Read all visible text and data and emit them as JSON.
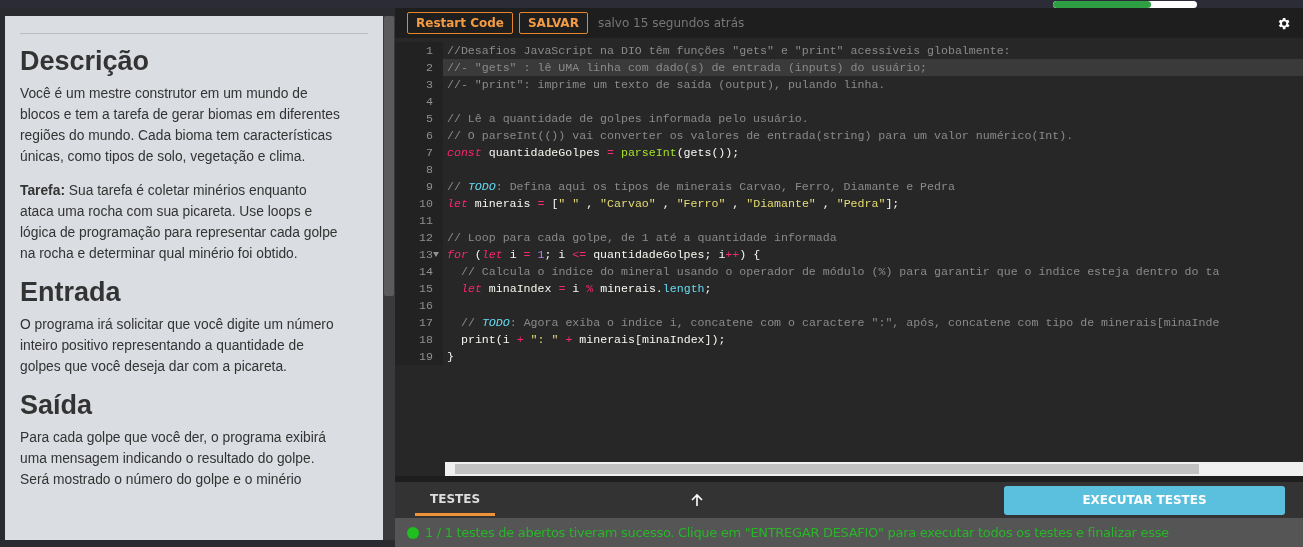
{
  "top_bar": {
    "progress": {
      "level": 0.68
    }
  },
  "description": {
    "sections": [
      {
        "heading": "Descrição",
        "paragraphs": [
          "Você é um mestre construtor em um mundo de blocos e tem a tarefa de gerar biomas em diferentes regiões do mundo. Cada bioma tem características únicas, como tipos de solo, vegetação e clima.",
          "**Tarefa:** Sua tarefa é coletar minérios enquanto ataca uma rocha com sua picareta. Use loops e lógica de programação para representar cada golpe na rocha e determinar qual minério foi obtido."
        ]
      },
      {
        "heading": "Entrada",
        "paragraphs": [
          "O programa irá solicitar que você digite um número inteiro positivo representando a quantidade de golpes que você deseja dar com a picareta."
        ]
      },
      {
        "heading": "Saída",
        "paragraphs": [
          "Para cada golpe que você der, o programa exibirá uma mensagem indicando o resultado do golpe. Será mostrado o número do golpe e o minério"
        ]
      }
    ]
  },
  "toolbar": {
    "buttons": [
      "Restart Code",
      "SALVAR"
    ],
    "save_status": "salvo 15 segundos atrás"
  },
  "editor": {
    "lines": [
      {
        "number": "1",
        "active": false,
        "foldable": false,
        "tokens": [
          {
            "kind": "comment",
            "text": "//Desafios JavaScript na DIO têm funções \"gets\" e \"print\" acessíveis globalmente:"
          }
        ]
      },
      {
        "number": "2",
        "active": true,
        "foldable": false,
        "tokens": [
          {
            "kind": "comment",
            "text": "//- \"gets\" : lê UMA linha com dado(s) de entrada (inputs) do usuário;"
          }
        ]
      },
      {
        "number": "3",
        "active": false,
        "foldable": false,
        "tokens": [
          {
            "kind": "comment",
            "text": "//- \"print\": imprime um texto de saída (output), pulando linha."
          }
        ]
      },
      {
        "number": "4",
        "active": false,
        "foldable": false
      },
      {
        "number": "5",
        "active": false,
        "foldable": false,
        "tokens": [
          {
            "kind": "comment",
            "text": "// Lê a quantidade de golpes informada pelo usuário."
          }
        ]
      },
      {
        "number": "6",
        "active": false,
        "foldable": false,
        "tokens": [
          {
            "kind": "comment",
            "text": "// O parseInt(()) vai converter os valores de entrada(string) para um valor numérico(Int)."
          }
        ]
      },
      {
        "number": "7",
        "active": false,
        "foldable": false,
        "tokens": [
          {
            "kind": "keyword",
            "text": "const"
          },
          {
            "kind": "plain",
            "text": " quantidadeGolpes "
          },
          {
            "kind": "operator",
            "text": "="
          },
          {
            "kind": "function",
            "text": " parseInt"
          },
          {
            "kind": "plain",
            "text": "(gets());"
          }
        ]
      },
      {
        "number": "8",
        "active": false,
        "foldable": false
      },
      {
        "number": "9",
        "active": false,
        "foldable": false,
        "tokens": [
          {
            "kind": "comment",
            "text": "// "
          },
          {
            "kind": "todo",
            "text": "TODO"
          },
          {
            "kind": "comment",
            "text": ": Defina aqui os tipos de minerais Carvao, Ferro, Diamante e Pedra"
          }
        ]
      },
      {
        "number": "10",
        "active": false,
        "foldable": false,
        "tokens": [
          {
            "kind": "keyword",
            "text": "let"
          },
          {
            "kind": "plain",
            "text": " minerais "
          },
          {
            "kind": "operator",
            "text": "="
          },
          {
            "kind": "plain",
            "text": " ["
          },
          {
            "kind": "string",
            "text": "\" \""
          },
          {
            "kind": "plain",
            "text": " , "
          },
          {
            "kind": "string",
            "text": "\"Carvao\""
          },
          {
            "kind": "plain",
            "text": " , "
          },
          {
            "kind": "string",
            "text": "\"Ferro\""
          },
          {
            "kind": "plain",
            "text": " , "
          },
          {
            "kind": "string",
            "text": "\"Diamante\""
          },
          {
            "kind": "plain",
            "text": " , "
          },
          {
            "kind": "string",
            "text": "\"Pedra\""
          },
          {
            "kind": "plain",
            "text": "];"
          }
        ]
      },
      {
        "number": "11",
        "active": false,
        "foldable": false
      },
      {
        "number": "12",
        "active": false,
        "foldable": false,
        "tokens": [
          {
            "kind": "comment",
            "text": "// Loop para cada golpe, de 1 até a quantidade informada"
          }
        ]
      },
      {
        "number": "13",
        "active": false,
        "foldable": true,
        "tokens": [
          {
            "kind": "keyword",
            "text": "for"
          },
          {
            "kind": "plain",
            "text": " ("
          },
          {
            "kind": "keyword",
            "text": "let"
          },
          {
            "kind": "plain",
            "text": " i "
          },
          {
            "kind": "operator",
            "text": "="
          },
          {
            "kind": "number",
            "text": " 1"
          },
          {
            "kind": "plain",
            "text": "; i "
          },
          {
            "kind": "operator",
            "text": "<="
          },
          {
            "kind": "plain",
            "text": " quantidadeGolpes; i"
          },
          {
            "kind": "operator",
            "text": "++"
          },
          {
            "kind": "plain",
            "text": ") {"
          }
        ]
      },
      {
        "number": "14",
        "active": false,
        "foldable": false,
        "indented": true,
        "tokens": [
          {
            "kind": "comment",
            "text": "// Calcula o índice do mineral usando o operador de módulo (%) para garantir que o índice esteja dentro do ta"
          }
        ]
      },
      {
        "number": "15",
        "active": false,
        "foldable": false,
        "indented": true,
        "tokens": [
          {
            "kind": "keyword",
            "text": "let"
          },
          {
            "kind": "plain",
            "text": " minaIndex "
          },
          {
            "kind": "operator",
            "text": "="
          },
          {
            "kind": "plain",
            "text": " i "
          },
          {
            "kind": "operator",
            "text": "%"
          },
          {
            "kind": "plain",
            "text": " minerais."
          },
          {
            "kind": "property",
            "text": "length"
          },
          {
            "kind": "plain",
            "text": ";"
          }
        ]
      },
      {
        "number": "16",
        "active": false,
        "foldable": false
      },
      {
        "number": "17",
        "active": false,
        "foldable": false,
        "indented": true,
        "tokens": [
          {
            "kind": "comment",
            "text": "// "
          },
          {
            "kind": "todo",
            "text": "TODO"
          },
          {
            "kind": "comment",
            "text": ": Agora exiba o índice i, concatene com o caractere \":\", após, concatene com tipo de minerais[minaInde"
          }
        ]
      },
      {
        "number": "18",
        "active": false,
        "foldable": false,
        "indented": true,
        "tokens": [
          {
            "kind": "plain",
            "text": "print(i "
          },
          {
            "kind": "operator",
            "text": "+"
          },
          {
            "kind": "string",
            "text": " \": \""
          },
          {
            "kind": "operator",
            "text": " +"
          },
          {
            "kind": "plain",
            "text": " minerais[minaIndex]);"
          }
        ]
      },
      {
        "number": "19",
        "active": false,
        "foldable": false,
        "tokens": [
          {
            "kind": "plain",
            "text": "}"
          }
        ]
      }
    ]
  },
  "tests": {
    "tabs": [
      {
        "label": "TESTES",
        "selected": true
      }
    ],
    "run_button": "EXECUTAR TESTES",
    "result": {
      "passed": true,
      "message": "1 / 1 testes de abertos tiveram sucesso. Clique em \"ENTREGAR DESAFIO\" para executar todos os testes e finalizar esse"
    }
  }
}
